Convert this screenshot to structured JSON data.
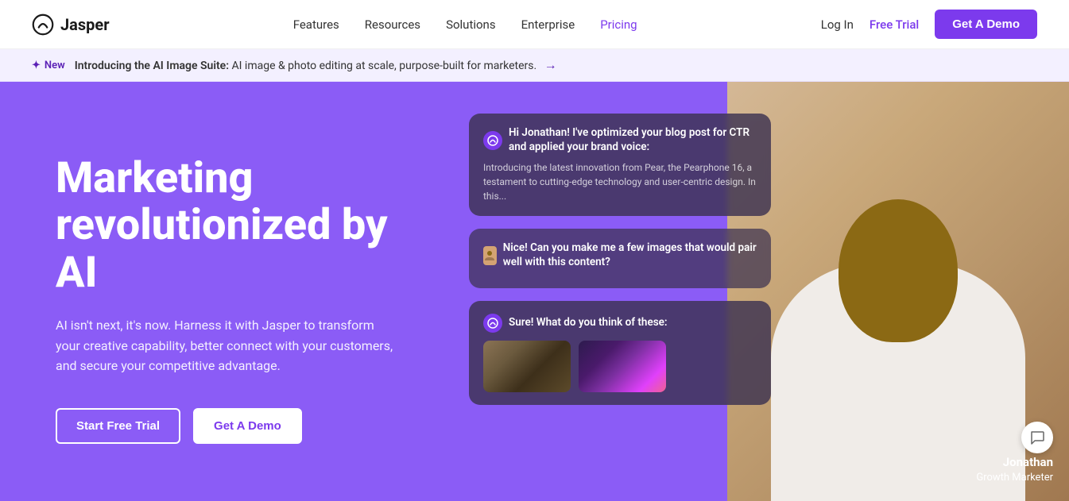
{
  "navbar": {
    "logo_text": "Jasper",
    "links": [
      {
        "label": "Features",
        "active": false
      },
      {
        "label": "Resources",
        "active": false
      },
      {
        "label": "Solutions",
        "active": false
      },
      {
        "label": "Enterprise",
        "active": false
      },
      {
        "label": "Pricing",
        "active": true
      }
    ],
    "login_label": "Log In",
    "free_trial_label": "Free Trial",
    "get_demo_label": "Get A Demo"
  },
  "announcement": {
    "new_label": "New",
    "star_icon": "✦",
    "bold_text": "Introducing the AI Image Suite:",
    "body_text": " AI image & photo editing at scale, purpose-built for marketers.",
    "arrow": "→"
  },
  "hero": {
    "title": "Marketing revolutionized by AI",
    "subtitle": "AI isn't next, it's now. Harness it with Jasper to transform your creative capability, better connect with your customers, and secure your competitive advantage.",
    "btn_trial": "Start Free Trial",
    "btn_demo": "Get A Demo",
    "chat1": {
      "title": "Hi Jonathan! I've optimized your blog post for CTR and applied your brand voice:",
      "body": "Introducing the latest innovation from Pear, the Pearphone 16, a testament to cutting-edge technology and user-centric design. In this..."
    },
    "chat2": {
      "body": "Nice! Can you make me a few images that would pair well with this content?"
    },
    "chat3": {
      "title": "Sure! What do you think of these:"
    },
    "person_name": "Jonathan",
    "person_role": "Growth Marketer"
  }
}
